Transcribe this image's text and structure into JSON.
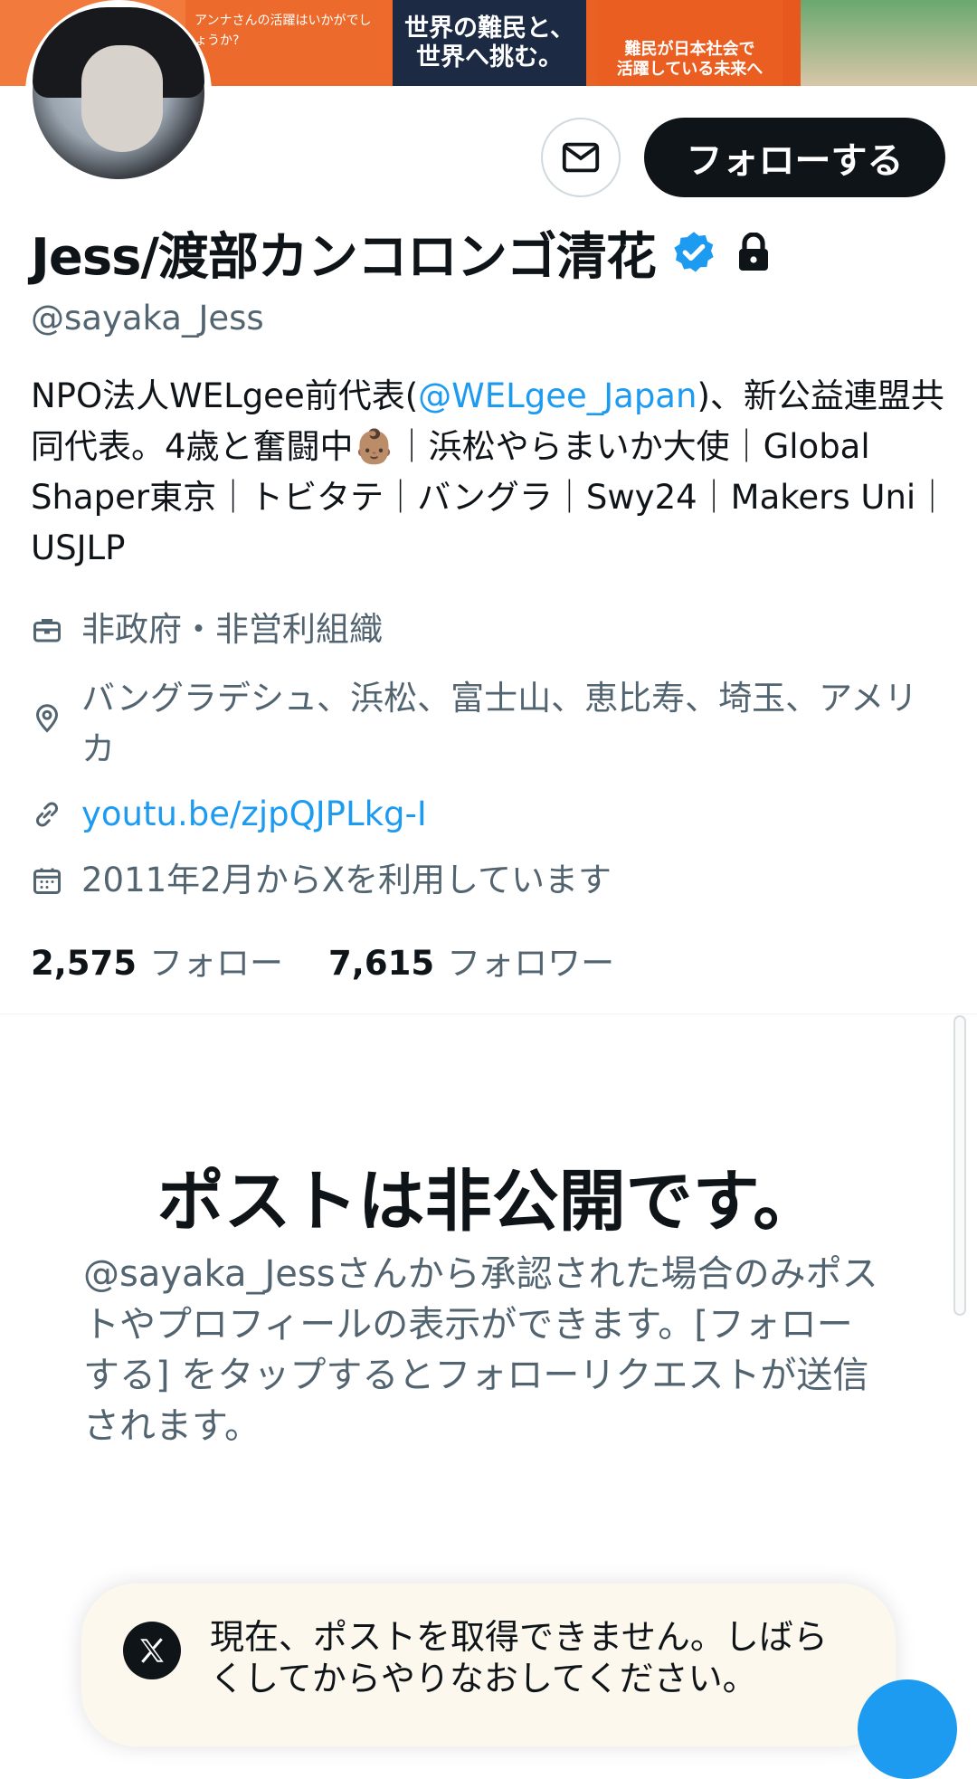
{
  "banner": {
    "text_left": "アンナさんの活躍はいかがでしょうか?",
    "headline_line1": "世界の難民と、",
    "headline_line2": "世界へ挑む。",
    "right_line1": "難民が日本社会で",
    "right_line2": "活躍している未来へ"
  },
  "profile": {
    "name": "Jess/渡部カンコロンゴ清花",
    "handle": "@sayaka_Jess",
    "follow_label": "フォローする",
    "bio_part1": "NPO法人WELgee前代表(",
    "bio_mention": "@WELgee_Japan",
    "bio_part2": ")、新公益連盟共同代表。4歳と奮闘中👶🏽｜浜松やらまいか大使｜Global Shaper東京｜トビタテ｜バングラ｜Swy24｜Makers Uni｜USJLP",
    "category": "非政府・非営利組織",
    "location": "バングラデシュ、浜松、富士山、恵比寿、埼玉、アメリカ",
    "url": "youtu.be/zjpQJPLkg-I",
    "joined": "2011年2月からXを利用しています",
    "following_count": "2,575",
    "following_label": "フォロー",
    "followers_count": "7,615",
    "followers_label": "フォロワー"
  },
  "private_notice": {
    "title": "ポストは非公開です。",
    "description": "@sayaka_Jessさんから承認された場合のみポストやプロフィールの表示ができます。[フォローする] をタップするとフォローリクエストが送信されます。"
  },
  "toast": {
    "message": "現在、ポストを取得できません。しばらくしてからやりなおしてください。"
  },
  "colors": {
    "accent": "#1d9bf0",
    "text_primary": "#0f1419",
    "text_secondary": "#536471",
    "banner_orange": "#e8581c"
  },
  "icons": [
    "message-icon",
    "verified-badge-icon",
    "lock-icon",
    "briefcase-icon",
    "location-pin-icon",
    "link-icon",
    "calendar-icon",
    "x-logo-icon"
  ]
}
